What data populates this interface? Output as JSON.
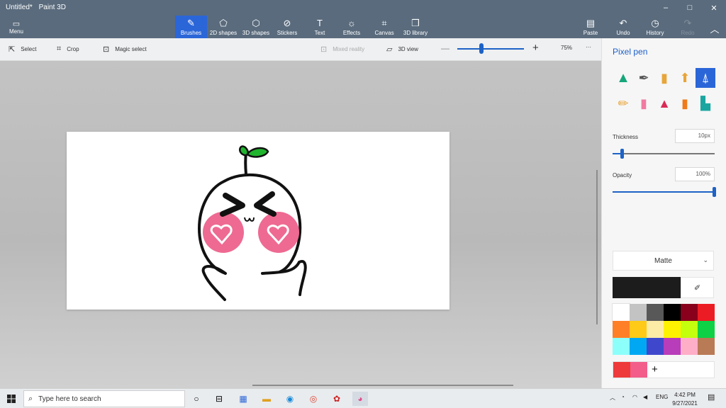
{
  "window": {
    "title": "Untitled*",
    "app_name": "Paint 3D",
    "controls": [
      "–",
      "□",
      "✕"
    ]
  },
  "ribbon": {
    "menu_label": "Menu",
    "tools": [
      {
        "label": "Brushes",
        "icon": "brush-icon"
      },
      {
        "label": "2D shapes",
        "icon": "2d-shapes-icon"
      },
      {
        "label": "3D shapes",
        "icon": "3d-shapes-icon"
      },
      {
        "label": "Stickers",
        "icon": "stickers-icon"
      },
      {
        "label": "Text",
        "icon": "text-icon"
      },
      {
        "label": "Effects",
        "icon": "effects-icon"
      },
      {
        "label": "Canvas",
        "icon": "canvas-icon"
      },
      {
        "label": "3D library",
        "icon": "3d-library-icon"
      }
    ],
    "right_tools": [
      {
        "label": "Paste",
        "icon": "paste-icon"
      },
      {
        "label": "Undo",
        "icon": "undo-icon"
      },
      {
        "label": "History",
        "icon": "history-icon"
      },
      {
        "label": "Redo",
        "icon": "redo-icon"
      }
    ]
  },
  "subbar": {
    "select_label": "Select",
    "crop_label": "Crop",
    "magic_select_label": "Magic select",
    "mixed_reality_label": "Mixed reality",
    "view_3d_label": "3D view",
    "zoom_value": "75%",
    "zoom_level": 0.34,
    "more_label": "···"
  },
  "panel": {
    "title": "Pixel pen",
    "brushes": [
      {
        "name": "marker-icon",
        "color": "#17a67a"
      },
      {
        "name": "calligraphy-pen-icon",
        "color": "#555555"
      },
      {
        "name": "oil-brush-icon",
        "color": "#e8a53a"
      },
      {
        "name": "watercolor-icon",
        "color": "#e8a53a"
      },
      {
        "name": "pixel-pen-icon",
        "color": "#ffffff"
      },
      {
        "name": "pencil-icon",
        "color": "#e8a53a"
      },
      {
        "name": "eraser-icon",
        "color": "#f07aa0"
      },
      {
        "name": "crayon-icon",
        "color": "#d92a57"
      },
      {
        "name": "spray-can-icon",
        "color": "#f07a1a"
      },
      {
        "name": "fill-icon",
        "color": "#1aa5a0"
      }
    ],
    "thickness_label": "Thickness",
    "thickness_value": "10px",
    "thickness_level": 0.1,
    "opacity_label": "Opacity",
    "opacity_value": "100%",
    "opacity_level": 1.0,
    "finish_label": "Matte",
    "current_color": "#1c1c1c",
    "palette": [
      "#ffffff",
      "#c3c3c3",
      "#585858",
      "#000000",
      "#88001b",
      "#ec1c24",
      "#ff7f27",
      "#ffca18",
      "#fdeca6",
      "#fff200",
      "#c4ff0e",
      "#0ed145",
      "#8cfffb",
      "#00a8f3",
      "#3f48cc",
      "#b83dba",
      "#ffaec8",
      "#b97a56"
    ],
    "custom_colors": [
      "#ee3a3a",
      "#f25d8a"
    ],
    "add_color_label": "+"
  },
  "taskbar": {
    "search_placeholder": "Type here to search",
    "apps": [
      "cortana-icon",
      "task-view-icon",
      "calculator-icon",
      "file-explorer-icon",
      "edge-icon",
      "chrome-icon",
      "app-red-icon",
      "paint-3d-icon"
    ],
    "language": "ENG",
    "time": "4:42 PM",
    "date": "9/27/2021"
  }
}
